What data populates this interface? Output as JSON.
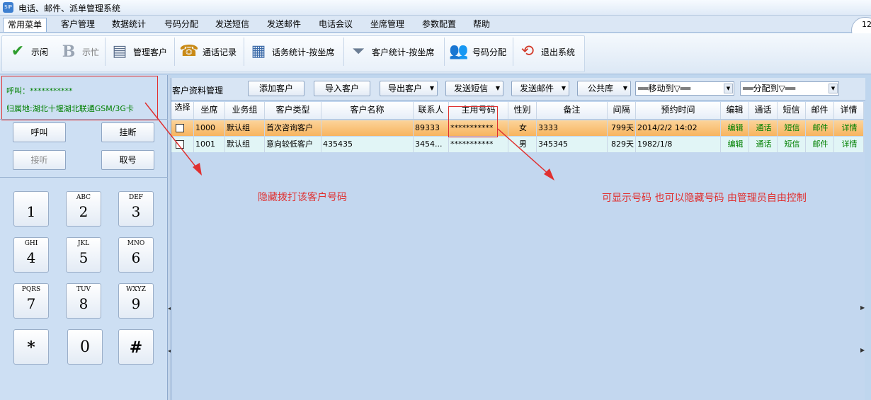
{
  "window": {
    "title": "电话、邮件、派单管理系统"
  },
  "menu": [
    "常用菜单",
    "客户管理",
    "数据统计",
    "号码分配",
    "发送短信",
    "发送邮件",
    "电话会议",
    "坐席管理",
    "参数配置",
    "帮助"
  ],
  "corner_button": "12",
  "toolbar": {
    "idle": "示闲",
    "busy": "示忙",
    "manage_customers": "管理客户",
    "call_records": "通话记录",
    "traffic_by_seat": "话务统计-按坐席",
    "customer_by_seat": "客户统计-按坐席",
    "number_assign": "号码分配",
    "exit": "退出系统"
  },
  "phone": {
    "call_label": "呼叫：***********",
    "location_label": "归属地:湖北十堰湖北联通GSM/3G卡",
    "call": "呼叫",
    "hangup": "挂断",
    "answer": "接听",
    "take_number": "取号",
    "keypad": [
      {
        "num": "1",
        "letters": ""
      },
      {
        "num": "2",
        "letters": "ABC"
      },
      {
        "num": "3",
        "letters": "DEF"
      },
      {
        "num": "4",
        "letters": "GHI"
      },
      {
        "num": "5",
        "letters": "JKL"
      },
      {
        "num": "6",
        "letters": "MNO"
      },
      {
        "num": "7",
        "letters": "PQRS"
      },
      {
        "num": "8",
        "letters": "TUV"
      },
      {
        "num": "9",
        "letters": "WXYZ"
      },
      {
        "num": "*",
        "letters": ""
      },
      {
        "num": "0",
        "letters": ""
      },
      {
        "num": "#",
        "letters": ""
      }
    ]
  },
  "panel": {
    "title": "客户资料管理",
    "add_customer": "添加客户",
    "import_customer": "导入客户",
    "export_customer": "导出客户",
    "send_sms": "发送短信",
    "send_email": "发送邮件",
    "public_pool": "公共库",
    "move_to": "══移动到▽══",
    "assign_to": "══分配到▽══"
  },
  "table": {
    "headers": [
      "选择",
      "坐席",
      "业务组",
      "客户类型",
      "客户名称",
      "联系人",
      "主用号码",
      "性别",
      "备注",
      "间隔",
      "预约时间",
      "编辑",
      "通话",
      "短信",
      "邮件",
      "详情"
    ],
    "rows": [
      [
        "",
        "1000",
        "默认组",
        "首次咨询客户",
        "",
        "89333",
        "***********",
        "女",
        "3333",
        "799天",
        "2014/2/2 14:02",
        "编辑",
        "通话",
        "短信",
        "邮件",
        "详情"
      ],
      [
        "",
        "1001",
        "默认组",
        "意向较低客户",
        "435435",
        "3454...",
        "***********",
        "男",
        "345345",
        "829天",
        "1982/1/8",
        "编辑",
        "通话",
        "短信",
        "邮件",
        "详情"
      ]
    ]
  },
  "annotations": {
    "left": "隐藏拨打该客户号码",
    "right": "可显示号码 也可以隐藏号码 由管理员自由控制"
  },
  "colors": {
    "annotation": "#e03030",
    "link": "#008000",
    "highlight_row": "#f7b45f"
  }
}
